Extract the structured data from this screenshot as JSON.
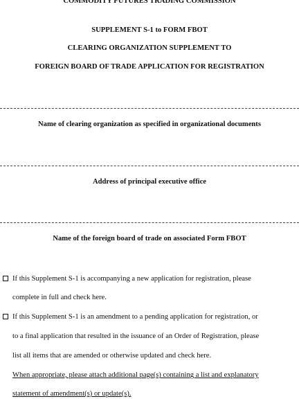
{
  "document": {
    "headings": [
      "COMMODITY FUTURES TRADING COMMISSION",
      "SUPPLEMENT S-1 to FORM FBOT",
      "CLEARING ORGANIZATION SUPPLEMENT TO",
      "FOREIGN BOARD OF TRADE APPLICATION FOR REGISTRATION"
    ],
    "fields": [
      {
        "label": "Name of clearing organization as specified in organizational documents"
      },
      {
        "label": "Address of principal executive office"
      },
      {
        "label": "Name of the foreign board of trade on associated Form FBOT"
      }
    ],
    "checkbox_items": [
      {
        "checked": false,
        "lines": [
          "If this Supplement S-1 is accompanying a new application for registration, please",
          "complete in full and check here."
        ]
      },
      {
        "checked": false,
        "lines": [
          "If this Supplement S-1 is an amendment to a pending application for registration, or",
          "to a final application that resulted in the issuance of an Order of Registration, please",
          "list all items that are amended or otherwise updated and check here."
        ]
      }
    ],
    "note_lines": [
      "When appropriate, please attach additional page(s) containing a list and explanatory",
      "statement of amendment(s) or update(s)."
    ]
  }
}
